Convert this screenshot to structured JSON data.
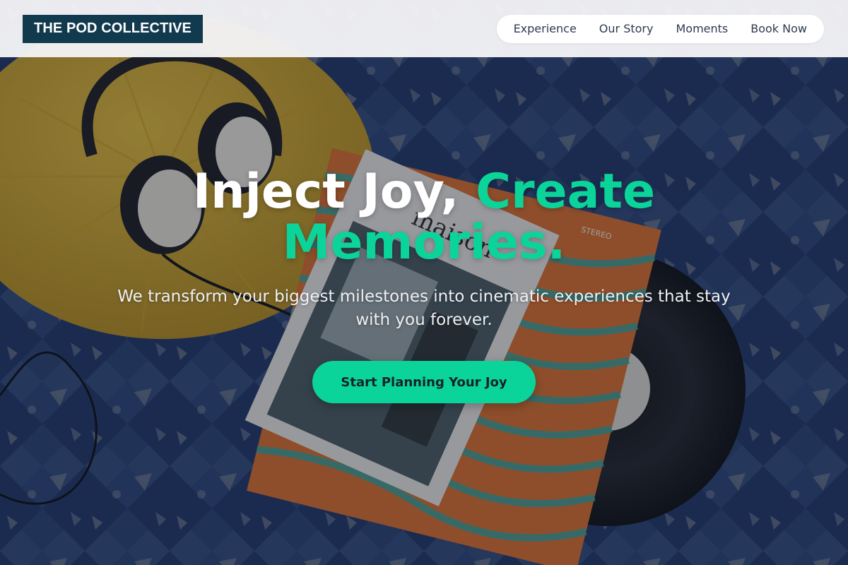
{
  "brand": {
    "logo_text": "THE POD COLLECTIVE"
  },
  "nav": {
    "items": [
      {
        "label": "Experience"
      },
      {
        "label": "Our Story"
      },
      {
        "label": "Moments"
      },
      {
        "label": "Book Now"
      }
    ]
  },
  "hero": {
    "headline_part1": "Inject Joy, ",
    "headline_accent": "Create Memories.",
    "subtext": "We transform your biggest milestones into cinematic experiences that stay with you forever.",
    "cta_label": "Start Planning Your Joy"
  },
  "background": {
    "record_label_text": "STEREO",
    "book_text": "maison"
  },
  "colors": {
    "accent": "#0bd49a",
    "logo_bg": "#123a4f",
    "nav_text": "#2e3a4f"
  }
}
